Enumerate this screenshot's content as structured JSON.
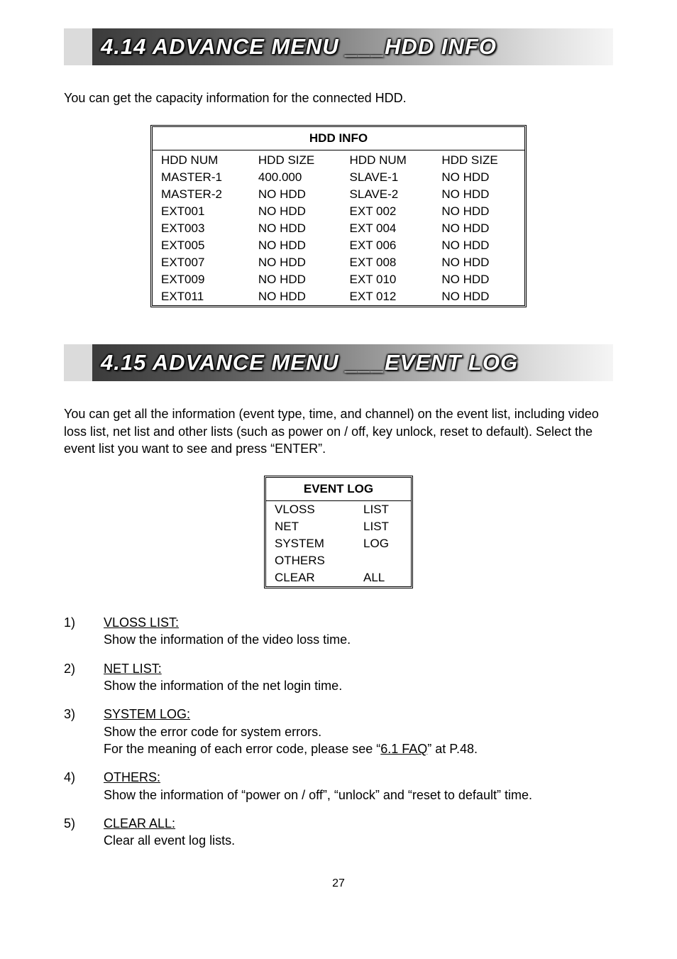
{
  "section1": {
    "headline": "4.14 ADVANCE MENU ___HDD INFO",
    "intro": "You can get the capacity information for the connected HDD.",
    "table_title": "HDD INFO",
    "columns": [
      "HDD NUM",
      "HDD SIZE",
      "HDD NUM",
      "HDD SIZE"
    ],
    "rows": [
      [
        "MASTER-1",
        "400.000",
        "SLAVE-1",
        "NO HDD"
      ],
      [
        "MASTER-2",
        "NO HDD",
        "SLAVE-2",
        "NO HDD"
      ],
      [
        "EXT001",
        "NO HDD",
        "EXT 002",
        "NO HDD"
      ],
      [
        "EXT003",
        "NO HDD",
        "EXT 004",
        "NO HDD"
      ],
      [
        "EXT005",
        "NO HDD",
        "EXT 006",
        "NO HDD"
      ],
      [
        "EXT007",
        "NO HDD",
        "EXT 008",
        "NO HDD"
      ],
      [
        "EXT009",
        "NO HDD",
        "EXT 010",
        "NO HDD"
      ],
      [
        "EXT011",
        "NO HDD",
        "EXT 012",
        "NO HDD"
      ]
    ]
  },
  "section2": {
    "headline": "4.15 ADVANCE MENU ___EVENT LOG",
    "intro": "You can get all the information (event type, time, and channel) on the event list, including video loss list, net list and other lists (such as power on / off, key unlock, reset to default). Select the event list you want to see and press “ENTER”.",
    "table_title": "EVENT LOG",
    "rows": [
      [
        "VLOSS",
        "LIST"
      ],
      [
        "NET",
        "LIST"
      ],
      [
        "SYSTEM",
        "LOG"
      ],
      [
        "OTHERS",
        ""
      ],
      [
        "CLEAR",
        "ALL"
      ]
    ],
    "defs": [
      {
        "num": "1)",
        "term": "VLOSS LIST:",
        "desc": "Show the information of the video loss time."
      },
      {
        "num": "2)",
        "term": "NET LIST:",
        "desc": "Show the information of the net login time."
      },
      {
        "num": "3)",
        "term": "SYSTEM LOG:",
        "desc_pre": "Show the error code for system errors.\nFor the meaning of each error code, please see “",
        "desc_link": "6.1 FAQ",
        "desc_post": "” at P.48."
      },
      {
        "num": "4)",
        "term": "OTHERS:",
        "desc": "Show the information of “power on / off”, “unlock” and “reset to default” time."
      },
      {
        "num": "5)",
        "term": "CLEAR ALL:",
        "desc": "Clear all event log lists."
      }
    ]
  },
  "page_number": "27"
}
